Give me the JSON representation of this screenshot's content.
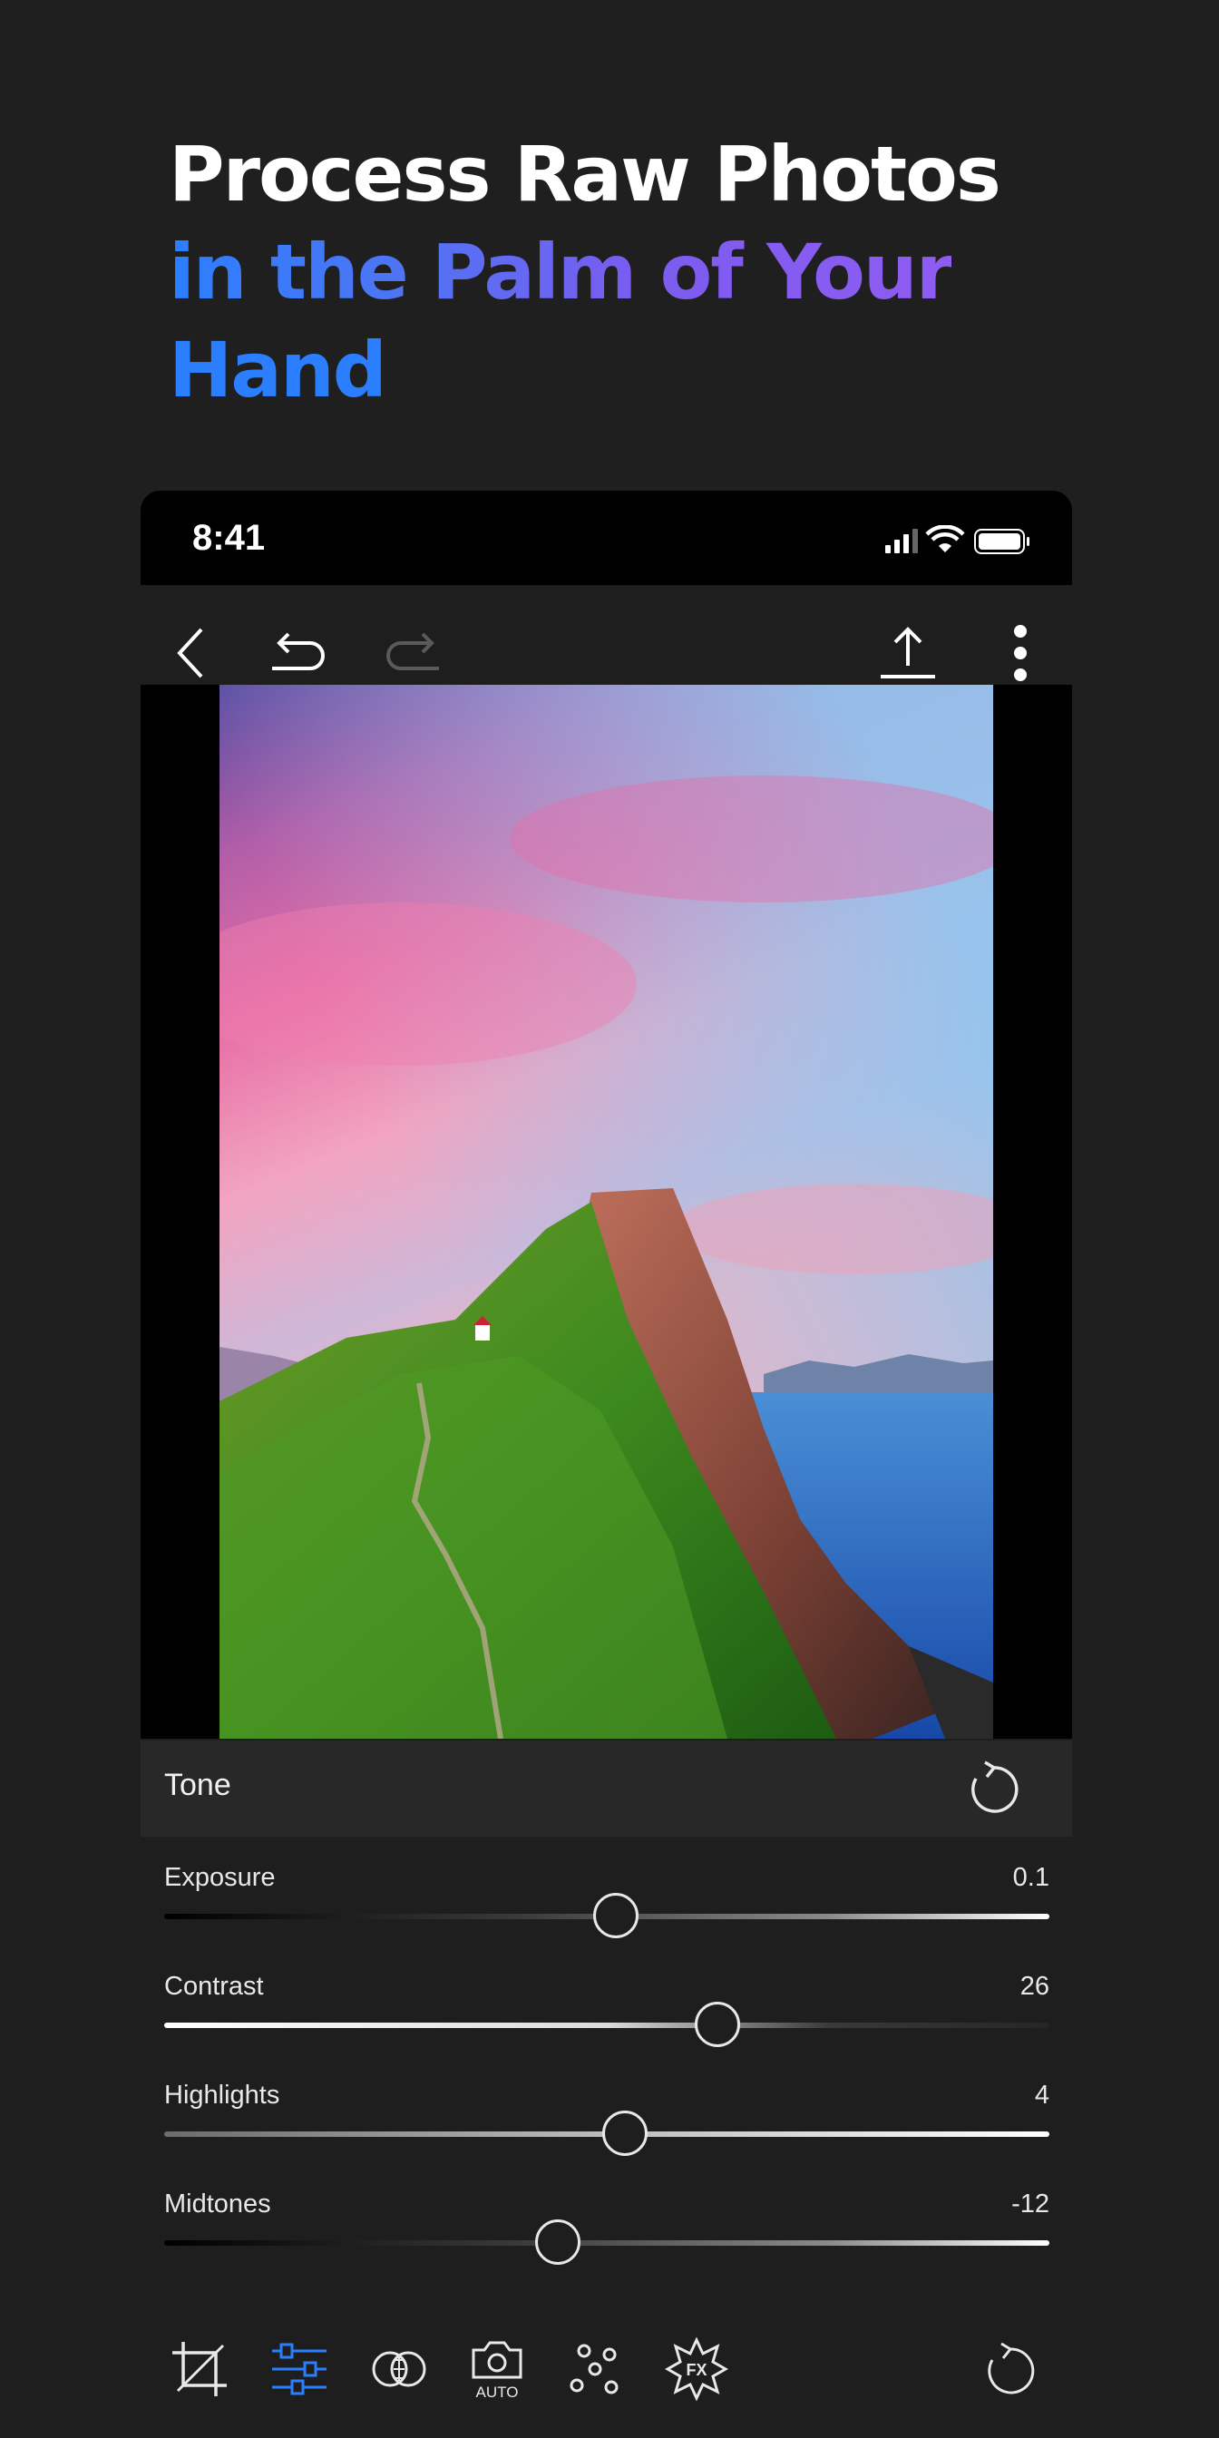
{
  "headline": {
    "line1": "Process Raw Photos",
    "line2": "in the Palm of Your",
    "line3": "Hand"
  },
  "status_bar": {
    "time": "8:41",
    "icons": [
      "cellular-signal-icon",
      "wifi-icon",
      "battery-icon"
    ]
  },
  "toolbar": {
    "icons": [
      "back-chevron-icon",
      "undo-icon",
      "redo-icon",
      "share-export-icon",
      "more-vertical-icon"
    ],
    "redo_enabled": false
  },
  "panel": {
    "title": "Tone",
    "sliders": [
      {
        "label": "Exposure",
        "value": "0.1",
        "position": 0.51
      },
      {
        "label": "Contrast",
        "value": "26",
        "position": 0.625
      },
      {
        "label": "Highlights",
        "value": "4",
        "position": 0.52
      },
      {
        "label": "Midtones",
        "value": "-12",
        "position": 0.445
      }
    ]
  },
  "bottom_tools": {
    "auto_label": "AUTO",
    "fx_label": "FX",
    "active": "adjust-sliders-icon",
    "accent_color": "#2b7fff",
    "icons": [
      "crop-icon",
      "adjust-sliders-icon",
      "blend-circles-icon",
      "auto-camera-icon",
      "dots-effects-icon",
      "fx-icon",
      "reset-icon"
    ]
  },
  "colors": {
    "background": "#1f1f1f",
    "accent_blue": "#2b7fff",
    "accent_purple": "#8f5cf2"
  }
}
